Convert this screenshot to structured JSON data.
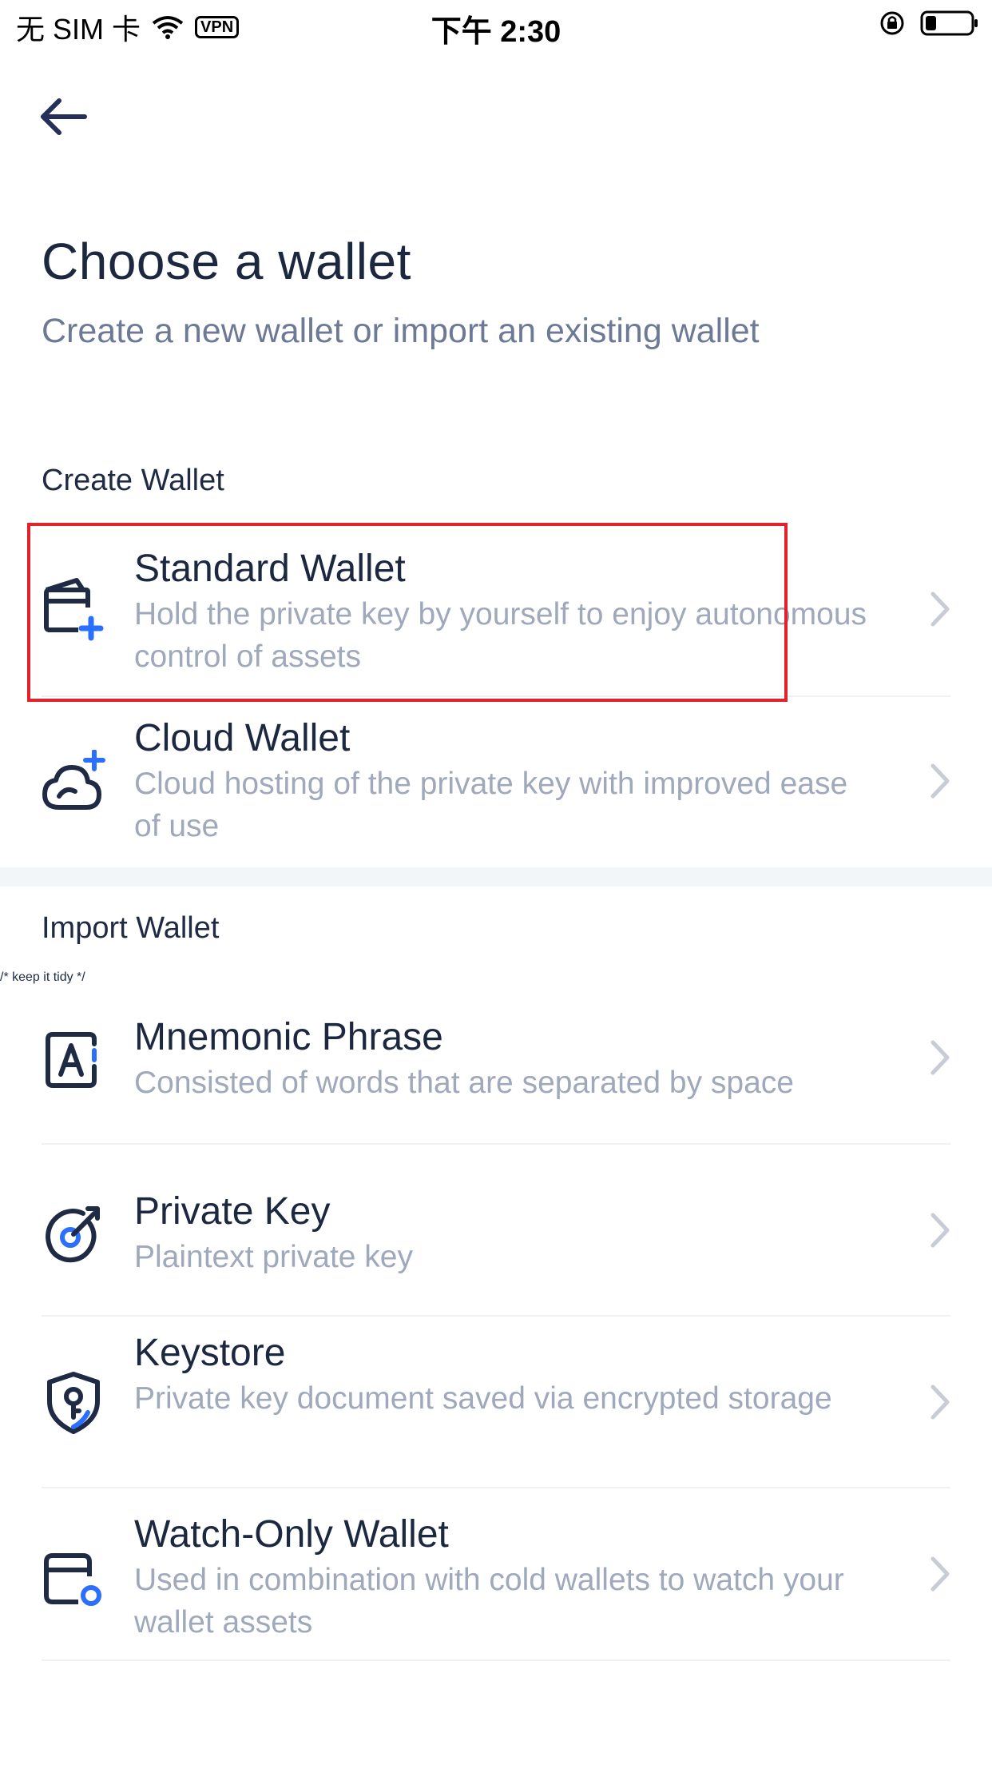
{
  "status_bar": {
    "carrier": "无 SIM 卡",
    "vpn": "VPN",
    "time": "下午 2:30"
  },
  "header": {
    "title": "Choose a wallet",
    "subtitle": "Create a new wallet or import an existing wallet"
  },
  "create_section": {
    "label": "Create Wallet",
    "items": [
      {
        "name": "Standard Wallet",
        "desc": "Hold the private key by yourself to enjoy autonomous control of assets",
        "icon": "wallet-plus-icon"
      },
      {
        "name": "Cloud Wallet",
        "desc": "Cloud hosting of the private key with improved ease of use",
        "icon": "cloud-plus-icon"
      }
    ]
  },
  "import_section": {
    "label": "Import Wallet",
    "items": [
      {
        "name": "Mnemonic Phrase",
        "desc": "Consisted of words that are separated by space",
        "icon": "mnemonic-icon"
      },
      {
        "name": "Private Key",
        "desc": "Plaintext private key",
        "icon": "key-target-icon"
      },
      {
        "name": "Keystore",
        "desc": "Private key document saved via encrypted storage",
        "icon": "shield-key-icon"
      },
      {
        "name": "Watch-Only Wallet",
        "desc": "Used in combination with cold wallets to watch your wallet assets",
        "icon": "wallet-watch-icon"
      }
    ]
  },
  "colors": {
    "accent": "#2b6fff",
    "icon_dark": "#1f2a44",
    "highlight": "#e3212b",
    "muted_text": "#a0a9bb"
  }
}
